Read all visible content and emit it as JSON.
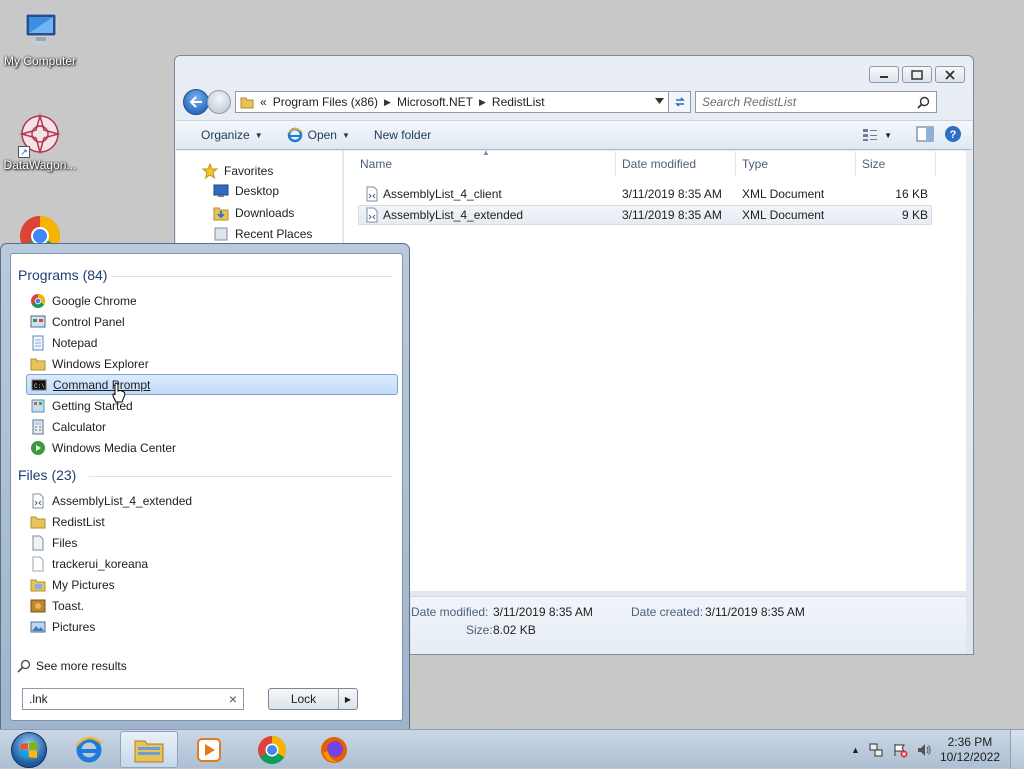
{
  "desktop": {
    "icons": [
      {
        "label": "My Computer",
        "icon": "computer-icon"
      },
      {
        "label": "DataWagon...",
        "icon": "datawagon-icon"
      },
      {
        "label": "",
        "icon": "chrome-icon"
      }
    ]
  },
  "explorer": {
    "address": {
      "overflow": "«",
      "crumbs": [
        "Program Files (x86)",
        "Microsoft.NET",
        "RedistList"
      ]
    },
    "search_placeholder": "Search RedistList",
    "toolbar": {
      "organize": "Organize",
      "open": "Open",
      "new_folder": "New folder"
    },
    "nav": {
      "favorites": "Favorites",
      "items": [
        "Desktop",
        "Downloads",
        "Recent Places"
      ]
    },
    "columns": {
      "name": "Name",
      "date": "Date modified",
      "type": "Type",
      "size": "Size"
    },
    "files": [
      {
        "name": "AssemblyList_4_client",
        "date": "3/11/2019 8:35 AM",
        "type": "XML Document",
        "size": "16 KB"
      },
      {
        "name": "AssemblyList_4_extended",
        "date": "3/11/2019 8:35 AM",
        "type": "XML Document",
        "size": "9 KB",
        "selected": true
      }
    ],
    "details": {
      "date_modified_label": "Date modified:",
      "date_modified": "3/11/2019 8:35 AM",
      "date_created_label": "Date created:",
      "date_created": "3/11/2019 8:35 AM",
      "size_label": "Size:",
      "size": "8.02 KB"
    }
  },
  "startmenu": {
    "programs_title": "Programs (84)",
    "programs": [
      {
        "label": "Google Chrome",
        "icon": "chrome-icon"
      },
      {
        "label": "Control Panel",
        "icon": "control-panel-icon"
      },
      {
        "label": "Notepad",
        "icon": "notepad-icon"
      },
      {
        "label": "Windows Explorer",
        "icon": "folder-icon"
      },
      {
        "label": "Command Prompt",
        "icon": "cmd-icon",
        "highlighted": true
      },
      {
        "label": "Getting Started",
        "icon": "getting-started-icon"
      },
      {
        "label": "Calculator",
        "icon": "calculator-icon"
      },
      {
        "label": "Windows Media Center",
        "icon": "media-center-icon"
      }
    ],
    "files_title": "Files (23)",
    "files": [
      {
        "label": "AssemblyList_4_extended",
        "icon": "xml-file-icon"
      },
      {
        "label": "RedistList",
        "icon": "folder-icon"
      },
      {
        "label": "Files",
        "icon": "file-icon"
      },
      {
        "label": "trackerui_koreana",
        "icon": "text-file-icon"
      },
      {
        "label": "My Pictures",
        "icon": "pictures-folder-icon"
      },
      {
        "label": "Toast.",
        "icon": "image-file-icon"
      },
      {
        "label": "Pictures",
        "icon": "pictures-icon"
      }
    ],
    "see_more": "See more results",
    "search_value": ".lnk",
    "clear": "×",
    "lock": "Lock"
  },
  "taskbar": {
    "apps": [
      "internet-explorer-icon",
      "windows-explorer-icon",
      "media-player-icon",
      "chrome-icon",
      "firefox-icon"
    ],
    "time": "2:36 PM",
    "date": "10/12/2022"
  }
}
